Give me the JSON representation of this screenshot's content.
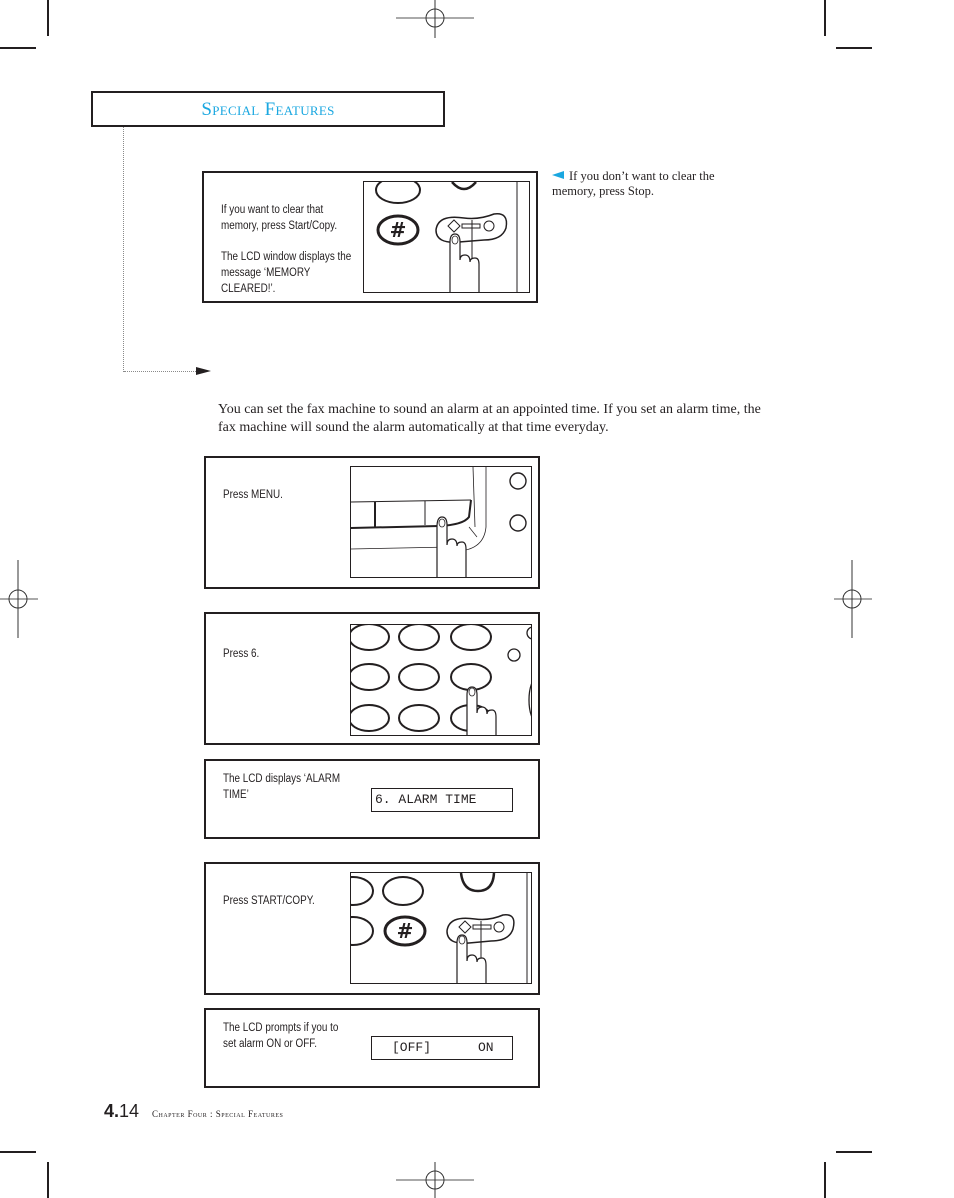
{
  "header": {
    "title": "Special Features"
  },
  "clear_memory": {
    "step_text_1": "If you want to clear that memory, press Start/Copy.",
    "step_text_2": "The LCD window displays the message ‘MEMORY CLEARED!’.",
    "side_note": "If you don’t want to clear the memory, press Stop.",
    "accent_color": "#1aa7e0"
  },
  "intro": {
    "paragraph": "You can set the fax machine to sound an alarm at an appointed time. If you set an alarm time, the fax machine will sound the alarm automatically at that time everyday."
  },
  "steps": [
    {
      "text": "Press MENU.",
      "illustration": "menu-button-press"
    },
    {
      "text": "Press 6.",
      "illustration": "keypad-6-press"
    },
    {
      "text": "The LCD displays ‘ALARM TIME’",
      "lcd": "6. ALARM TIME"
    },
    {
      "text": "Press START/COPY.",
      "illustration": "start-copy-press"
    },
    {
      "text": "The LCD prompts if you to set alarm ON or OFF.",
      "lcd_left": "[OFF]",
      "lcd_right": "ON"
    }
  ],
  "footer": {
    "page_prefix": "4.",
    "page_number": "14",
    "chapter": "Chapter Four : Special Features"
  }
}
